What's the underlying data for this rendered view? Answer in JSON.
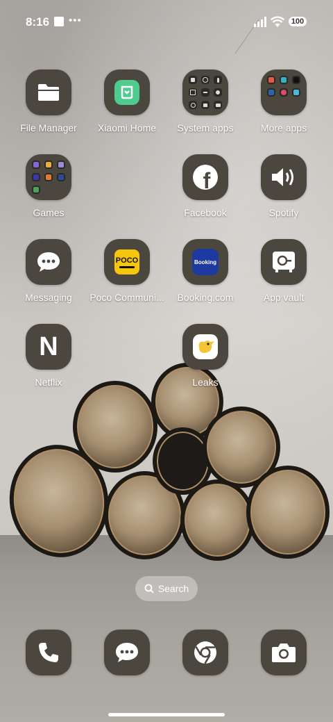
{
  "status_bar": {
    "time": "8:16",
    "battery": "100"
  },
  "apps": [
    {
      "label": "File Manager"
    },
    {
      "label": "Xiaomi Home"
    },
    {
      "label": "System apps"
    },
    {
      "label": "More apps"
    },
    {
      "label": "Games"
    },
    {
      "label": "Facebook"
    },
    {
      "label": "Spotify"
    },
    {
      "label": "Messaging"
    },
    {
      "label": "Poco Communi..."
    },
    {
      "label": "Booking.com"
    },
    {
      "label": "App vault"
    },
    {
      "label": "Netflix"
    },
    {
      "label": "Leaks"
    }
  ],
  "icons_text": {
    "poco": "POCO",
    "booking": "Booking",
    "netflix": "N"
  },
  "search": {
    "label": "Search"
  },
  "colors": {
    "tile": "#4b463e",
    "xiaomi_home": "#4ecb8d",
    "poco": "#f6c60d",
    "booking": "#1c3aa0",
    "leaks": "#f3c433"
  }
}
